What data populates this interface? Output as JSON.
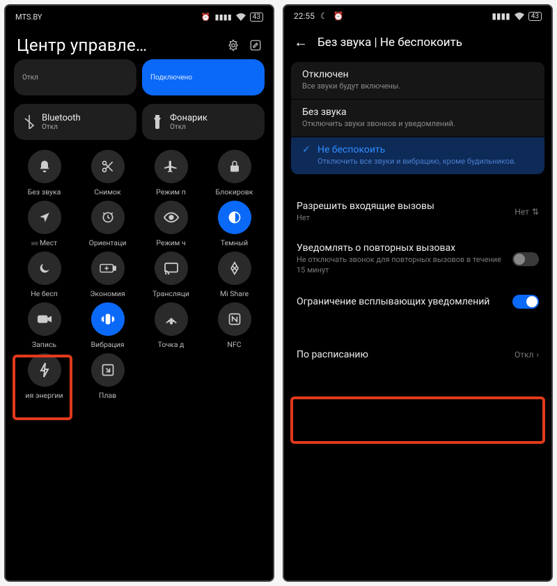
{
  "left": {
    "carrier": "MTS.BY",
    "battery": "43",
    "title": "Центр управле…",
    "big_tiles": [
      {
        "label": "",
        "sub": "Откл",
        "on": false
      },
      {
        "label": "",
        "sub": "Подключено",
        "on": true
      }
    ],
    "big_tiles2": [
      {
        "label": "Bluetooth",
        "sub": "Откл",
        "icon": "bluetooth-icon"
      },
      {
        "label": "Фонарик",
        "sub": "Откл",
        "icon": "flashlight-icon"
      }
    ],
    "grid": [
      {
        "label": "Без звука",
        "icon": "bell-icon",
        "on": false
      },
      {
        "label": "Снимок",
        "icon": "scissors-icon",
        "on": false
      },
      {
        "label": "Режим п",
        "icon": "airplane-icon",
        "on": false
      },
      {
        "label": "Блокировк",
        "icon": "lock-icon",
        "on": false
      },
      {
        "label": "Мест",
        "prefix": "ие",
        "icon": "location-icon",
        "on": false
      },
      {
        "label": "Ориентаци",
        "icon": "rotation-lock-icon",
        "on": false
      },
      {
        "label": "Режим ч",
        "icon": "eye-icon",
        "on": false
      },
      {
        "label": "Темный",
        "icon": "dark-mode-icon",
        "on": true
      },
      {
        "label": "Не бесп",
        "icon": "moon-icon",
        "on": false
      },
      {
        "label": "Экономия",
        "icon": "battery-plus-icon",
        "on": false
      },
      {
        "label": "Трансляци",
        "icon": "cast-icon",
        "on": false
      },
      {
        "label": "Mi Share",
        "icon": "mishare-icon",
        "on": false
      },
      {
        "label": "Запись",
        "icon": "record-icon",
        "on": false
      },
      {
        "label": "Вибрация",
        "icon": "vibrate-icon",
        "on": true
      },
      {
        "label": "Точка д",
        "icon": "hotspot-icon",
        "on": false
      },
      {
        "label": "NFC",
        "icon": "nfc-icon",
        "on": false
      },
      {
        "label": "ия энергии",
        "icon": "bolt-icon",
        "on": false
      },
      {
        "label": "Плав",
        "icon": "pip-icon",
        "on": false
      }
    ]
  },
  "right": {
    "time": "22:55",
    "battery": "43",
    "page_title": "Без звука | Не беспокоить",
    "options": [
      {
        "title": "Отключен",
        "sub": "Все звуки будут включены.",
        "selected": false
      },
      {
        "title": "Без звука",
        "sub": "Отключить звуки звонков и уведомлений.",
        "selected": false
      },
      {
        "title": "Не беспокоить",
        "sub": "Отключить все звуки и вибрацию, кроме будильников.",
        "selected": true
      }
    ],
    "settings": {
      "incoming": {
        "title": "Разрешить входящие вызовы",
        "sub": "Нет",
        "value": "Нет"
      },
      "repeat": {
        "title": "Уведомлять о повторных вызовах",
        "sub": "Не отключать звонок для повторных вызовов в течение 15 минут",
        "on": false
      },
      "popup": {
        "title": "Ограничение всплывающих уведомлений",
        "on": true
      },
      "schedule": {
        "title": "По расписанию",
        "value": "Откл"
      }
    }
  }
}
